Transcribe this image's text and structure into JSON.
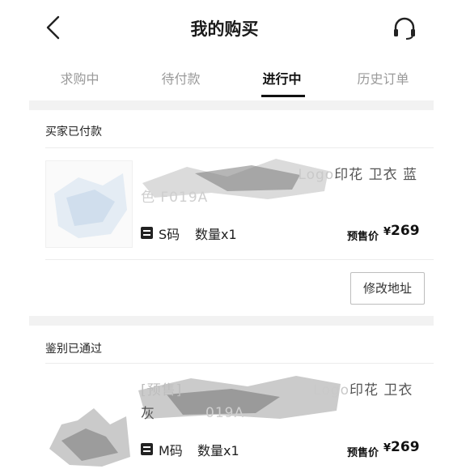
{
  "header": {
    "title": "我的购买",
    "back_icon": "chevron-left-icon",
    "service_icon": "headset-icon"
  },
  "tabs": [
    {
      "label": "求购中",
      "active": false
    },
    {
      "label": "待付款",
      "active": false
    },
    {
      "label": "进行中",
      "active": true
    },
    {
      "label": "历史订单",
      "active": false
    }
  ],
  "orders": [
    {
      "status": "买家已付款",
      "name_line1": "印花 卫衣 蓝",
      "name_line2": "色 F019A",
      "name_logo": "Logo",
      "spec_icon": "size-tag-icon",
      "size": "S码",
      "quantity": "数量x1",
      "price_label": "预售价",
      "currency": "¥",
      "price": "269",
      "action_button": "修改地址"
    },
    {
      "status": "鉴别已通过",
      "name_prefix": "[预售]",
      "name_logo": "Logo",
      "name_line1": "印花 卫衣 灰",
      "name_line2": "019A",
      "spec_icon": "size-tag-icon",
      "size": "M码",
      "quantity": "数量x1",
      "price_label": "预售价",
      "currency": "¥",
      "price": "269"
    }
  ],
  "colors": {
    "background_gap": "#f2f2f2",
    "text_primary": "#111111",
    "text_muted": "#9a9a9a"
  }
}
